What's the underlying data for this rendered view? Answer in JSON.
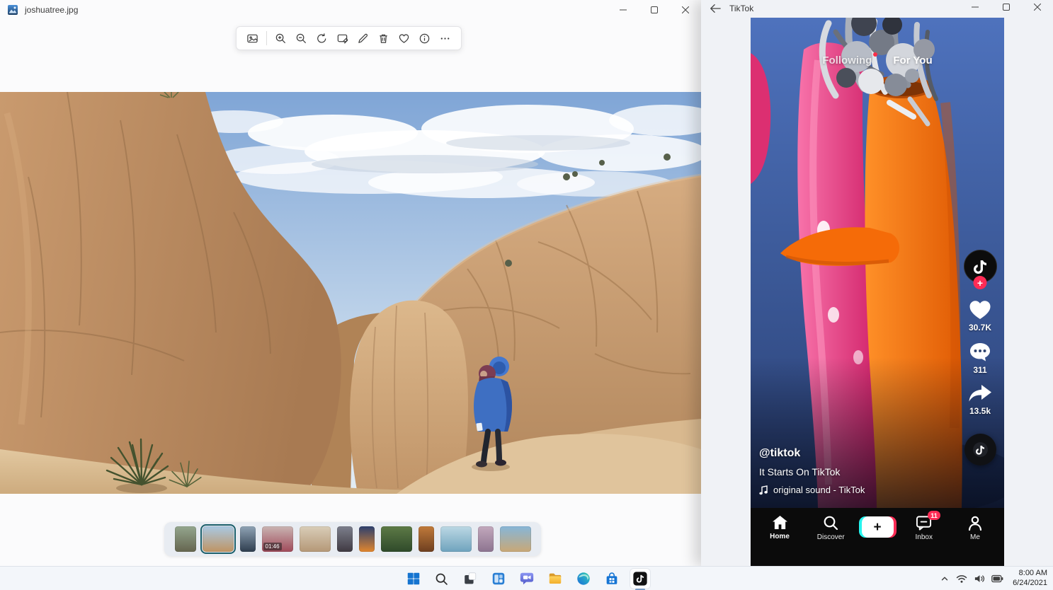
{
  "photos_app": {
    "window_title": "joshuatree.jpg",
    "toolbar": {
      "icons": [
        "see-all-photos",
        "zoom-in",
        "zoom-out",
        "rotate",
        "crop-edit",
        "draw",
        "delete",
        "favorite",
        "info",
        "more"
      ]
    },
    "window_controls": [
      "minimize",
      "maximize",
      "close"
    ],
    "filmstrip": {
      "thumbnails": [
        {
          "shape": "med",
          "colors": [
            "#94a68e",
            "#65654f"
          ]
        },
        {
          "shape": "wide",
          "selected": true,
          "colors": [
            "#a9c9e3",
            "#bf9463"
          ]
        },
        {
          "shape": "tall",
          "colors": [
            "#8fa3b5",
            "#2e3d4e"
          ]
        },
        {
          "shape": "wide",
          "duration": "01:46",
          "colors": [
            "#c9b4b2",
            "#a04a5a"
          ]
        },
        {
          "shape": "wide",
          "colors": [
            "#d9cdb8",
            "#b59877"
          ]
        },
        {
          "shape": "tall",
          "colors": [
            "#7c7f8c",
            "#403a42"
          ]
        },
        {
          "shape": "tall",
          "colors": [
            "#2c3f6e",
            "#e0862e"
          ]
        },
        {
          "shape": "wide",
          "colors": [
            "#5d7a46",
            "#2f4a2a"
          ]
        },
        {
          "shape": "tall",
          "colors": [
            "#c07a3a",
            "#6e3f20"
          ]
        },
        {
          "shape": "wide",
          "colors": [
            "#bcd8e4",
            "#6fa3bd"
          ]
        },
        {
          "shape": "tall",
          "colors": [
            "#c2a8bc",
            "#8d7490"
          ]
        },
        {
          "shape": "wide",
          "colors": [
            "#86b6d8",
            "#c9a876"
          ]
        }
      ]
    }
  },
  "tiktok_app": {
    "window_title": "TikTok",
    "tabs": [
      {
        "label": "Following",
        "active": false,
        "has_notification_dot": true
      },
      {
        "label": "For You",
        "active": true
      }
    ],
    "engagement": {
      "likes": "30.7K",
      "comments": "311",
      "shares": "13.5k"
    },
    "caption": {
      "username": "@tiktok",
      "text": "It Starts On TikTok",
      "sound": "original sound - TikTok"
    },
    "nav": {
      "home": "Home",
      "discover": "Discover",
      "inbox": "Inbox",
      "me": "Me",
      "inbox_badge": "11"
    }
  },
  "taskbar": {
    "icons": [
      "start",
      "search",
      "task-view",
      "widgets",
      "chat",
      "file-explorer",
      "edge",
      "store",
      "tiktok"
    ],
    "active_app": "tiktok",
    "tray": {
      "time": "8:00 AM",
      "date": "6/24/2021",
      "icons": [
        "hidden-icons-chevron",
        "wifi",
        "volume",
        "battery"
      ]
    }
  },
  "colors": {
    "tiktok_red": "#fe2c55",
    "tiktok_cyan": "#25f4ee",
    "filmstrip_selection": "#1b5f6b",
    "taskbar_bg": "#f3f6fa"
  }
}
